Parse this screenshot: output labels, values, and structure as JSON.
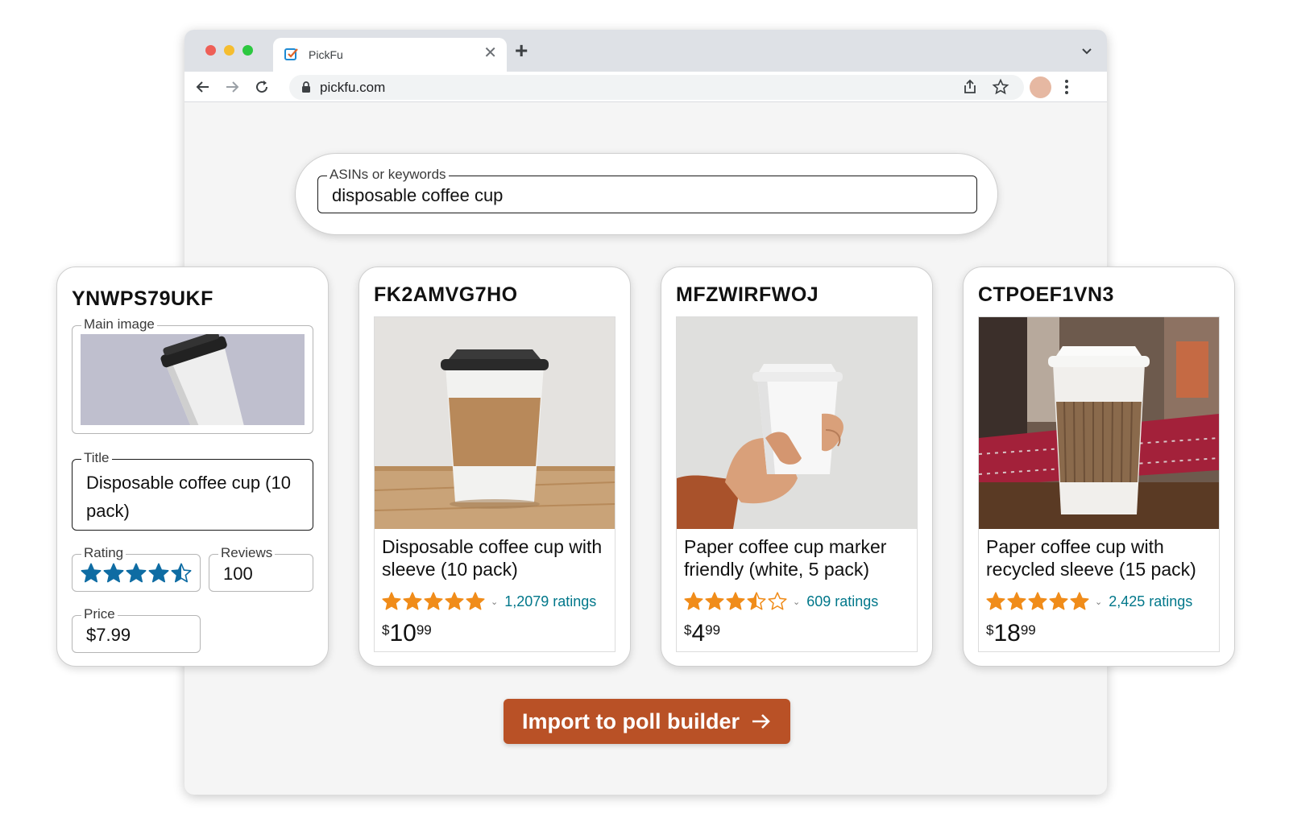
{
  "browser": {
    "tab_title": "PickFu",
    "url": "pickfu.com"
  },
  "search": {
    "label": "ASINs or keywords",
    "value": "disposable coffee cup"
  },
  "editor": {
    "asin": "YNWPS79UKF",
    "main_image_label": "Main image",
    "title_label": "Title",
    "title_value": "Disposable coffee cup (10 pack)",
    "rating_label": "Rating",
    "rating_value": 4.5,
    "reviews_label": "Reviews",
    "reviews_value": "100",
    "price_label": "Price",
    "price_value": "$7.99"
  },
  "products": [
    {
      "asin": "FK2AMVG7HO",
      "title": "Disposable coffee cup with sleeve (10 pack)",
      "rating": 5,
      "ratings_text": "1,2079 ratings",
      "price_currency": "$",
      "price_whole": "10",
      "price_fraction": "99"
    },
    {
      "asin": "MFZWIRFWOJ",
      "title": "Paper coffee cup marker friendly (white, 5 pack)",
      "rating": 3.5,
      "ratings_text": "609 ratings",
      "price_currency": "$",
      "price_whole": "4",
      "price_fraction": "99"
    },
    {
      "asin": "CTPOEF1VN3",
      "title": "Paper coffee cup with recycled sleeve (15 pack)",
      "rating": 5,
      "ratings_text": "2,425 ratings",
      "price_currency": "$",
      "price_whole": "18",
      "price_fraction": "99"
    }
  ],
  "import_button": {
    "label": "Import to poll builder",
    "icon": "arrow-right-icon"
  },
  "colors": {
    "accent_button": "#b95126",
    "amazon_star": "#f08c1a",
    "editor_star": "#0e6ca3",
    "ratings_link": "#00778a"
  }
}
